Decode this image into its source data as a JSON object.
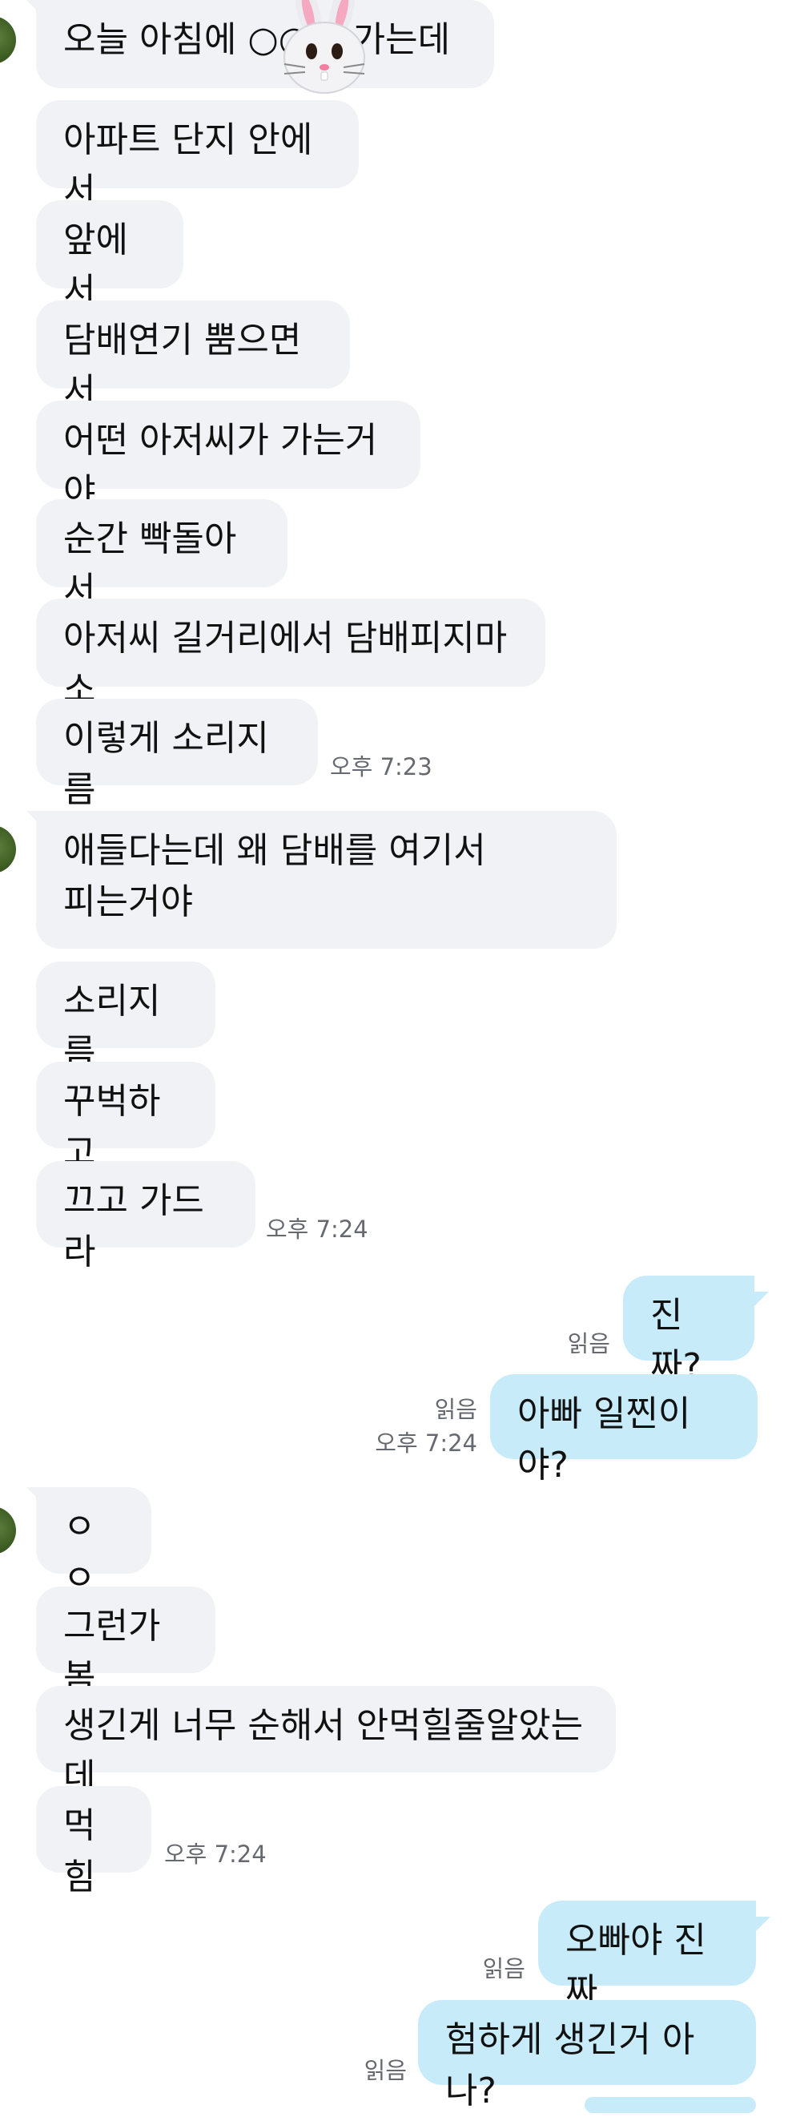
{
  "messages": [
    {
      "text": "오늘 아침에 ○○랑 가는데"
    },
    {
      "text": "아파트 단지 안에서"
    },
    {
      "text": "앞에서"
    },
    {
      "text": "담배연기 뿜으면서"
    },
    {
      "text": "어떤 아저씨가 가는거야"
    },
    {
      "text": "순간 빡돌아서"
    },
    {
      "text": "아저씨 길거리에서 담배피지마소"
    },
    {
      "text": "이렇게 소리지름"
    },
    {
      "text": "애들다는데 왜 담배를 여기서\n피는거야"
    },
    {
      "text": "소리지름"
    },
    {
      "text": "꾸벅하고"
    },
    {
      "text": "끄고 가드라"
    },
    {
      "text": "진짜?"
    },
    {
      "text": "아빠 일찐이야?"
    },
    {
      "text": "ㅇㅇ"
    },
    {
      "text": "그런가봄"
    },
    {
      "text": "생긴게 너무 순해서 안먹힐줄알았는데"
    },
    {
      "text": "먹힘"
    },
    {
      "text": "오빠야 진짜"
    },
    {
      "text": "험하게 생긴거 아나?"
    }
  ],
  "meta": {
    "time_723": "오후 7:23",
    "time_724": "오후 7:24",
    "read": "읽음"
  },
  "emoji": {
    "icon": "rabbit-face-icon"
  },
  "colors": {
    "incoming": "#f1f2f6",
    "outgoing": "#c8ebfa"
  }
}
